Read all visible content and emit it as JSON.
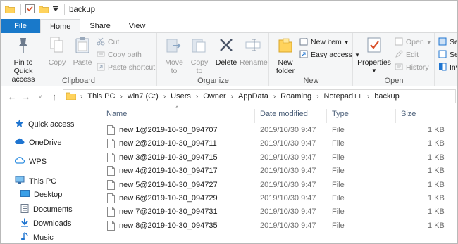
{
  "window": {
    "title": "backup",
    "quick_access_toolbar": [
      "folder-icon",
      "properties-check-icon",
      "new-folder-icon",
      "customize-dropdown-icon"
    ]
  },
  "tabs": [
    {
      "label": "File",
      "active": false
    },
    {
      "label": "Home",
      "active": true
    },
    {
      "label": "Share",
      "active": false
    },
    {
      "label": "View",
      "active": false
    }
  ],
  "ribbon": {
    "clipboard": {
      "label": "Clipboard",
      "pin": "Pin to Quick access",
      "copy": "Copy",
      "paste": "Paste",
      "cut": "Cut",
      "copy_path": "Copy path",
      "paste_shortcut": "Paste shortcut"
    },
    "organize": {
      "label": "Organize",
      "move_to": "Move to",
      "copy_to": "Copy to",
      "delete": "Delete",
      "rename": "Rename"
    },
    "new": {
      "label": "New",
      "new_folder": "New folder",
      "new_item": "New item",
      "easy_access": "Easy access"
    },
    "open": {
      "label": "Open",
      "properties": "Properties",
      "open": "Open",
      "edit": "Edit",
      "history": "History"
    },
    "select": {
      "select_all": "Sel",
      "select_none": "Sel",
      "invert_selection": "Inv"
    }
  },
  "address_bar": {
    "path": [
      "This PC",
      "win7 (C:)",
      "Users",
      "Owner",
      "AppData",
      "Roaming",
      "Notepad++",
      "backup"
    ]
  },
  "nav_pane": {
    "items": [
      {
        "label": "Quick access",
        "icon": "star-icon"
      },
      {
        "label": "OneDrive",
        "icon": "cloud-icon"
      },
      {
        "label": "WPS",
        "icon": "wps-cloud-icon"
      },
      {
        "label": "This PC",
        "icon": "computer-icon"
      },
      {
        "label": "Desktop",
        "icon": "desktop-icon"
      },
      {
        "label": "Documents",
        "icon": "documents-icon"
      },
      {
        "label": "Downloads",
        "icon": "download-icon"
      },
      {
        "label": "Music",
        "icon": "music-icon"
      }
    ]
  },
  "file_list": {
    "columns": {
      "name": "Name",
      "date": "Date modified",
      "type": "Type",
      "size": "Size"
    },
    "sort_column": "name",
    "rows": [
      {
        "name": "new 1@2019-10-30_094707",
        "date": "2019/10/30 9:47",
        "type": "File",
        "size": "1 KB"
      },
      {
        "name": "new 2@2019-10-30_094711",
        "date": "2019/10/30 9:47",
        "type": "File",
        "size": "1 KB"
      },
      {
        "name": "new 3@2019-10-30_094715",
        "date": "2019/10/30 9:47",
        "type": "File",
        "size": "1 KB"
      },
      {
        "name": "new 4@2019-10-30_094717",
        "date": "2019/10/30 9:47",
        "type": "File",
        "size": "1 KB"
      },
      {
        "name": "new 5@2019-10-30_094727",
        "date": "2019/10/30 9:47",
        "type": "File",
        "size": "1 KB"
      },
      {
        "name": "new 6@2019-10-30_094729",
        "date": "2019/10/30 9:47",
        "type": "File",
        "size": "1 KB"
      },
      {
        "name": "new 7@2019-10-30_094731",
        "date": "2019/10/30 9:47",
        "type": "File",
        "size": "1 KB"
      },
      {
        "name": "new 8@2019-10-30_094735",
        "date": "2019/10/30 9:47",
        "type": "File",
        "size": "1 KB"
      }
    ]
  },
  "colors": {
    "file_tab": "#1979ca",
    "folder": "#ffd35c",
    "header_text": "#4c607a",
    "accent_blue": "#1e74d0"
  }
}
